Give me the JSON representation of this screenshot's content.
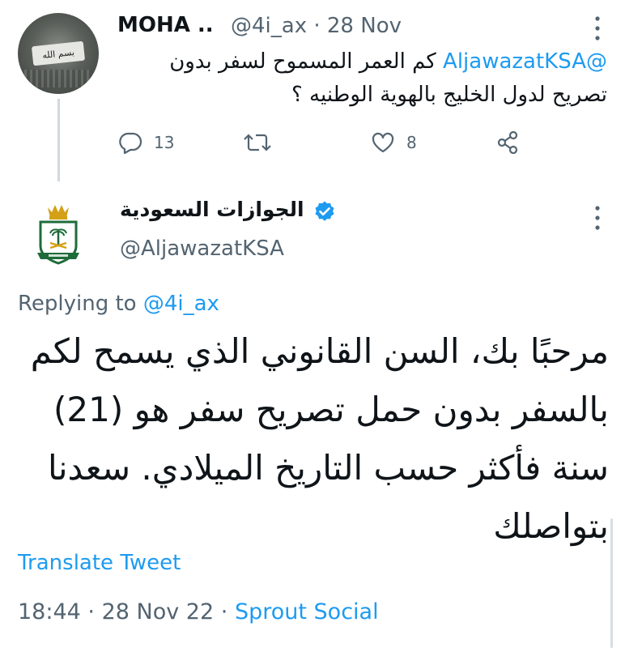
{
  "tweet1": {
    "display_name": "MOHA ..",
    "handle": "@4i_ax",
    "separator": "·",
    "date": "28 Nov",
    "mention": "@AljawazatKSA",
    "text_line1": "كم العمر المسموح لسفر بدون",
    "text_line2": "تصريح لدول الخليج بالهوية الوطنيه ؟",
    "reply_count": "13",
    "retweet_count": "",
    "like_count": "8"
  },
  "tweet2": {
    "display_name": "الجوازات السعودية",
    "handle": "@AljawazatKSA",
    "replying_prefix": "Replying to ",
    "replying_handle": "@4i_ax",
    "body": "مرحبًا بك، السن القانوني الذي يسمح لكم بالسفر بدون حمل تصريح سفر هو (21) سنة فأكثر حسب التاريخ الميلادي. سعدنا بتواصلك",
    "translate_label": "Translate Tweet",
    "time": "18:44",
    "date": "28 Nov 22",
    "separator": "·",
    "source": "Sprout Social"
  },
  "colors": {
    "text": "#0f1419",
    "secondary": "#536471",
    "link": "#1d9bf0",
    "thread_line": "#cfd9de",
    "seal_green": "#1f6b3a",
    "seal_gold": "#d4a017"
  },
  "icons": [
    "more-icon",
    "reply-icon",
    "retweet-icon",
    "like-icon",
    "share-icon",
    "verified-badge-icon"
  ]
}
